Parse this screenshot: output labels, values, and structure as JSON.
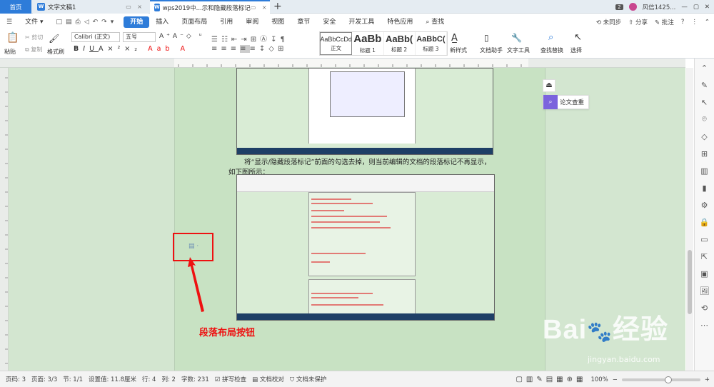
{
  "titlebar": {
    "tabs": [
      {
        "label": "首页"
      },
      {
        "label": "文字文稿1"
      },
      {
        "label": "wps2019中...示和隐藏段落标记"
      }
    ],
    "badge": "2",
    "user": "风信1425...",
    "add_tab_symbol": "+"
  },
  "menubar": {
    "file": "文件",
    "items": [
      "开始",
      "插入",
      "页面布局",
      "引用",
      "审阅",
      "视图",
      "章节",
      "安全",
      "开发工具",
      "特色应用"
    ],
    "active": "开始",
    "search": "查找",
    "right": {
      "sync": "未同步",
      "share": "分享",
      "comment": "批注"
    }
  },
  "ribbon": {
    "paste": "粘贴",
    "cut": "剪切",
    "copy": "复制",
    "format_painter": "格式刷",
    "font_name": "Calibri (正文)",
    "font_size": "五号",
    "styles": [
      {
        "sample": "AaBbCcDd",
        "name": "正文"
      },
      {
        "sample": "AaBb",
        "name": "标题 1"
      },
      {
        "sample": "AaBb(",
        "name": "标题 2"
      },
      {
        "sample": "AaBbC(",
        "name": "标题 3"
      }
    ],
    "new_style": "新样式",
    "doc_assistant": "文档助手",
    "text_tools": "文字工具",
    "find_replace": "查找替换",
    "select": "选择"
  },
  "document": {
    "para_line1": "将“显示/隐藏段落标记”前面的勾选去掉，则当前编辑的文档的段落标记不再显示，",
    "para_line2": "如下图所示：",
    "annotation": "段落布局按钮"
  },
  "panel": {
    "thesis_check": "论文查重"
  },
  "statusbar": {
    "page_no": "页码: 3",
    "pages": "页面: 3/3",
    "section": "节: 1/1",
    "setting": "设置值: 11.8厘米",
    "row": "行: 4",
    "col": "列: 2",
    "words": "字数: 231",
    "spell": "拼写检查",
    "proof": "文档校对",
    "unprotected": "文档未保护",
    "zoom": "100%"
  },
  "watermark": {
    "brand": "Bai",
    "brand2": "经验",
    "url": "jingyan.baidu.com"
  },
  "colors": {
    "accent": "#2e7cd9",
    "annotation": "#e11111",
    "canvas": "#d3e6d0"
  }
}
